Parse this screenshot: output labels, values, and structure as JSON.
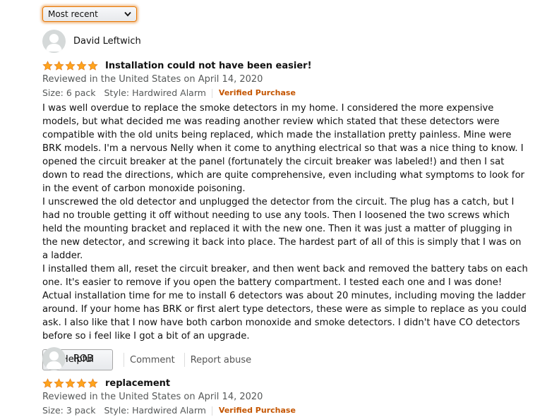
{
  "sort": {
    "selected": "Most recent"
  },
  "colors": {
    "star": "#ffa41c",
    "verified": "#c45500",
    "focus": "#e77600"
  },
  "reviews": [
    {
      "reviewer": "David Leftwich",
      "rating": 5,
      "title": "Installation could not have been easier!",
      "date": "Reviewed in the United States on April 14, 2020",
      "size": "Size: 6 pack",
      "style": "Style: Hardwired Alarm",
      "verified": "Verified Purchase",
      "paragraphs": [
        "I was well overdue to replace the smoke detectors in my home. I considered the more expensive models, but what decided me was reading another review which stated that these detectors were compatible with the old units being replaced, which made the installation pretty painless. Mine were BRK models. I'm a nervous Nelly when it come to anything electrical so that was a nice thing to know. I opened the circuit breaker at the panel (fortunately the circuit breaker was labeled!) and then I sat down to read the directions, which are quite comprehensive, even including what symptoms to look for in the event of carbon monoxide poisoning.",
        "I unscrewed the old detector and unplugged the detector from the circuit. The plug has a catch, but I had no trouble getting it off without needing to use any tools. Then I loosened the two screws which held the mounting bracket and replaced it with the new one. Then it was just a matter of plugging in the new detector, and screwing it back into place. The hardest part of all of this is simply that I was on a ladder.",
        "I installed them all, reset the circuit breaker, and then went back and removed the battery tabs on each one. It's easier to remove if you open the battery compartment. I tested each one and I was done! Actual installation time for me to install 6 detectors was about 20 minutes, including moving the ladder around. If your home has BRK or first alert type detectors, these were as simple to replace as you could ask. I also like that I now have both carbon monoxide and smoke detectors. I didn't have CO detectors before so i feel like I got a bit of an upgrade."
      ],
      "actions": {
        "helpful": "Helpful",
        "comment": "Comment",
        "report": "Report abuse"
      }
    },
    {
      "reviewer": "ROB",
      "rating": 5,
      "title": "replacement",
      "date": "Reviewed in the United States on April 14, 2020",
      "size": "Size: 3 pack",
      "style": "Style: Hardwired Alarm",
      "verified": "Verified Purchase"
    }
  ]
}
